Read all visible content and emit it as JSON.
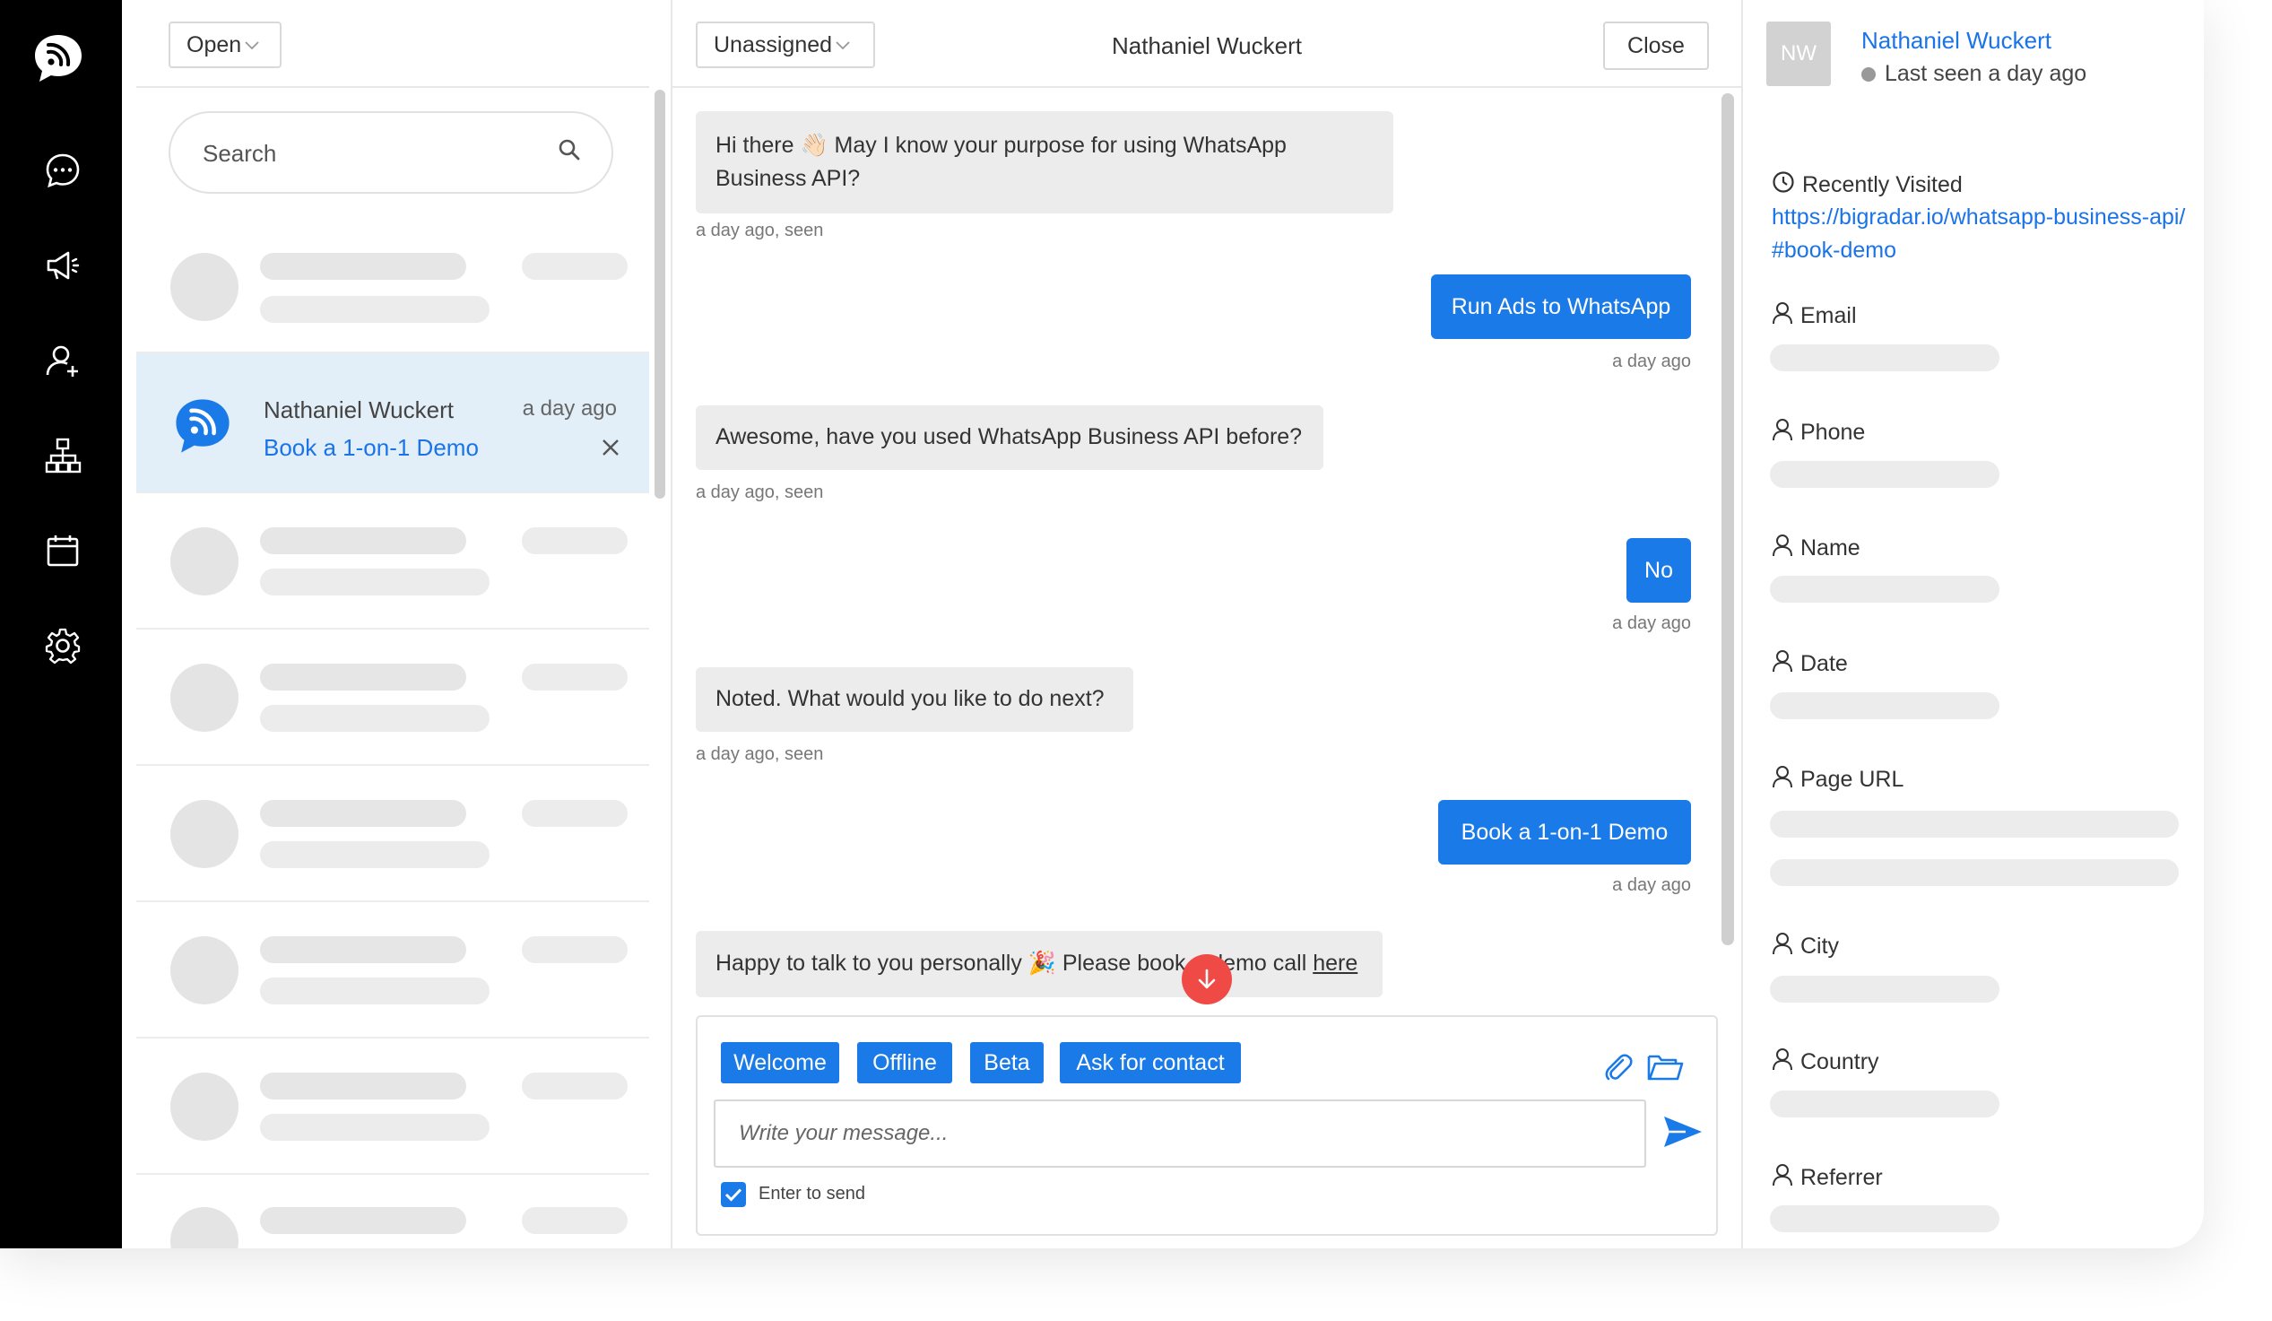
{
  "list": {
    "status_filter": "Open",
    "search_placeholder": "Search",
    "active_conversation": {
      "name": "Nathaniel Wuckert",
      "time": "a day ago",
      "preview": "Book a 1-on-1 Demo"
    }
  },
  "chat": {
    "assign_filter": "Unassigned",
    "title": "Nathaniel Wuckert",
    "close_label": "Close",
    "messages": [
      {
        "dir": "in",
        "text": "Hi there 👋🏻 May I know your purpose for using WhatsApp Business API?",
        "meta": "a day ago, seen"
      },
      {
        "dir": "out",
        "text": "Run Ads to WhatsApp",
        "meta": "a day ago"
      },
      {
        "dir": "in",
        "text": "Awesome, have you used WhatsApp Business API before?",
        "meta": "a day ago, seen"
      },
      {
        "dir": "out",
        "text": "No",
        "meta": "a day ago"
      },
      {
        "dir": "in",
        "text": "Noted. What would you like to do next?",
        "meta": "a day ago, seen"
      },
      {
        "dir": "out",
        "text": "Book a 1-on-1 Demo",
        "meta": "a day ago"
      },
      {
        "dir": "in",
        "text_before": "Happy to talk to you personally 🎉 Please book a demo call",
        "link": "here"
      }
    ],
    "quick_replies": [
      "Welcome",
      "Offline",
      "Beta",
      "Ask for contact"
    ],
    "input_placeholder": "Write your message...",
    "enter_to_send_label": "Enter to send",
    "enter_to_send_checked": true
  },
  "profile": {
    "initials": "NW",
    "name": "Nathaniel Wuckert",
    "status": "Last seen a day ago",
    "recently_visited_label": "Recently Visited",
    "recently_visited_url": "https://bigradar.io/whatsapp-business-api/#book-demo",
    "fields": [
      "Email",
      "Phone",
      "Name",
      "Date",
      "Page URL",
      "City",
      "Country",
      "Referrer"
    ]
  },
  "colors": {
    "accent": "#1a7ae8",
    "sidebar": "#000000",
    "active_row": "#e3eff8",
    "scroll_down_button": "#f04a46"
  },
  "icons": {
    "nav": [
      "chat-logo-icon",
      "messages-icon",
      "megaphone-icon",
      "contacts-icon",
      "workflow-icon",
      "calendar-icon",
      "settings-icon"
    ]
  }
}
